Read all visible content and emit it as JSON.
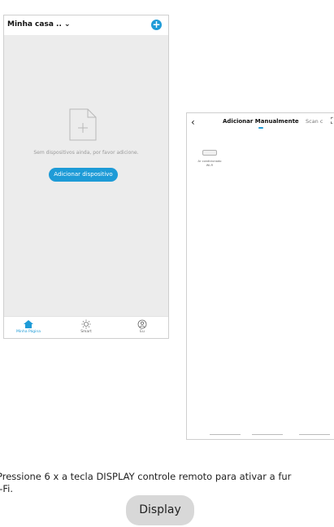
{
  "home": {
    "title": "Minha casa ..",
    "add_icon": "plus-circle-icon",
    "empty_text": "Sem dispositivos ainda, por favor adicione.",
    "add_device_button": "Adicionar dispositivo",
    "tabs": [
      {
        "label": "Minha Página",
        "icon": "home-icon",
        "active": true
      },
      {
        "label": "Smart",
        "icon": "sun-icon",
        "active": false
      },
      {
        "label": "Eu",
        "icon": "user-circle-icon",
        "active": false
      }
    ]
  },
  "manual": {
    "title": "Adicionar Manualmente",
    "scan_tab": "Scan c",
    "device": {
      "line1": "Ar condicionado",
      "line2": "Wi-Fi"
    }
  },
  "instruction": {
    "line1": "Pressione 6 x a tecla DISPLAY controle remoto para ativar a fur",
    "line2": "i-Fi."
  },
  "display_button": "Display",
  "colors": {
    "accent": "#1e9bd7",
    "background": "#ececec"
  }
}
